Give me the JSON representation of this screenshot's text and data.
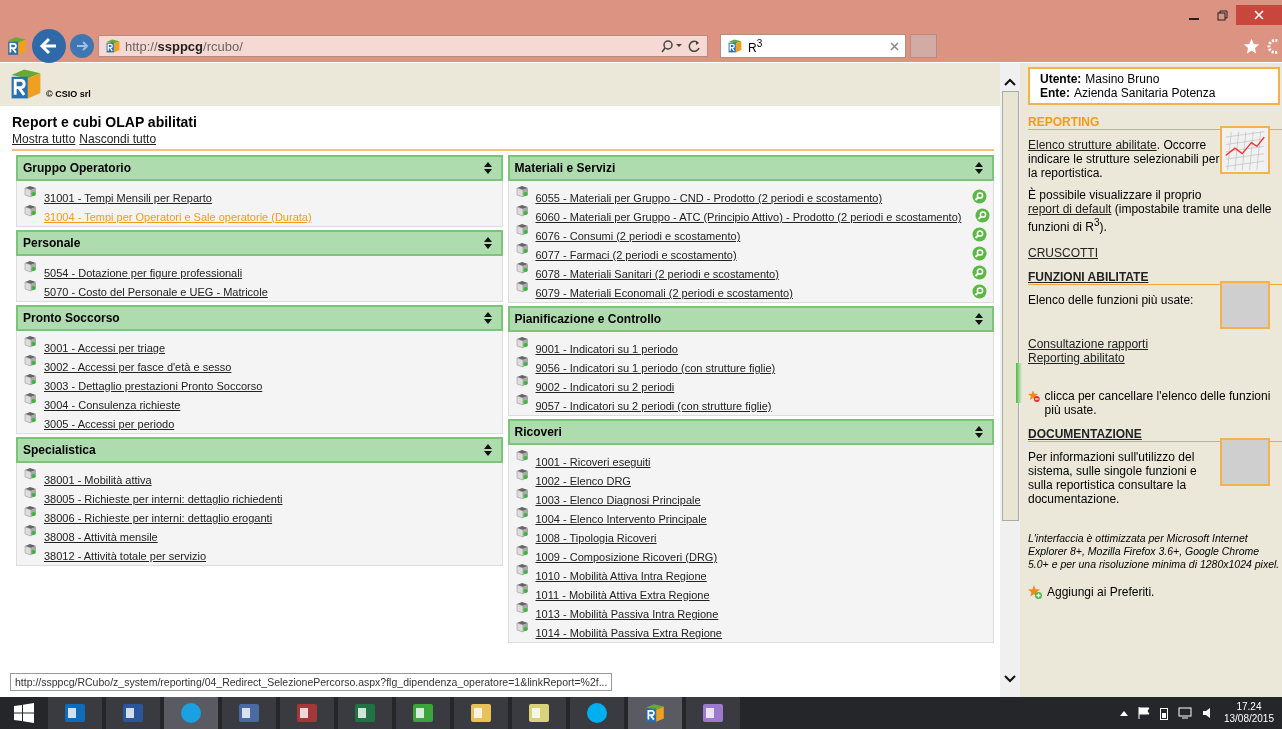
{
  "browser": {
    "url": "http://**ssppcg**/rcubo/",
    "tab_title": "R$^{3}$"
  },
  "header": {
    "copyright": "© CSIO srl",
    "user": [
      {
        "label": "Utente:",
        "value": "Masino Bruno"
      },
      {
        "label": "Ente:",
        "value": "Azienda Sanitaria Potenza"
      }
    ]
  },
  "main": {
    "title": "Report e cubi OLAP abilitati",
    "links": [
      "Mostra tutto",
      "Nascondi tutto"
    ],
    "columns": [
      [
        {
          "title": "Gruppo Operatorio",
          "item_actions": false,
          "items": [
            {
              "text": "31001 - Tempi Mensili per Reparto",
              "highlighted": false
            },
            {
              "text": "31004 - Tempi per Operatori e Sale operatorie (Durata)",
              "highlighted": true
            }
          ]
        },
        {
          "title": "Personale",
          "item_actions": false,
          "items": [
            {
              "text": "5054 - Dotazione per figure professionali ",
              "highlighted": false
            },
            {
              "text": "5070 - Costo del Personale e UEG - Matricole",
              "highlighted": false
            }
          ]
        },
        {
          "title": "Pronto Soccorso",
          "item_actions": false,
          "items": [
            {
              "text": "3001 - Accessi per triage",
              "highlighted": false
            },
            {
              "text": "3002 - Accessi per fasce d'età e sesso",
              "highlighted": false
            },
            {
              "text": "3003 - Dettaglio prestazioni Pronto Soccorso",
              "highlighted": false
            },
            {
              "text": "3004 - Consulenza richieste",
              "highlighted": false
            },
            {
              "text": "3005 - Accessi per periodo",
              "highlighted": false
            }
          ]
        },
        {
          "title": "Specialistica",
          "item_actions": false,
          "items": [
            {
              "text": "38001 - Mobilità attiva",
              "highlighted": false
            },
            {
              "text": "38005 - Richieste per interni: dettaglio richiedenti",
              "highlighted": false
            },
            {
              "text": "38006 - Richieste per interni: dettaglio eroganti",
              "highlighted": false
            },
            {
              "text": "38008 - Attività mensile",
              "highlighted": false
            },
            {
              "text": "38012 - Attività totale per servizio",
              "highlighted": false
            }
          ]
        }
      ],
      [
        {
          "title": "Materiali e Servizi",
          "item_actions": true,
          "items": [
            {
              "text": "6055 - Materiali per Gruppo - CND - Prodotto (2 periodi e scostamento) ",
              "highlighted": false
            },
            {
              "text": "6060 - Materiali per Gruppo - ATC (Principio Attivo) - Prodotto (2 periodi e scostamento)",
              "highlighted": false
            },
            {
              "text": "6076 - Consumi (2 periodi e scostamento)",
              "highlighted": false
            },
            {
              "text": "6077 - Farmaci (2 periodi e scostamento)",
              "highlighted": false
            },
            {
              "text": "6078 - Materiali Sanitari (2 periodi e scostamento)",
              "highlighted": false
            },
            {
              "text": "6079 - Materiali Economali (2 periodi e scostamento)",
              "highlighted": false
            }
          ]
        },
        {
          "title": "Pianificazione e Controllo",
          "item_actions": false,
          "items": [
            {
              "text": "9001 - Indicatori su 1 periodo",
              "highlighted": false
            },
            {
              "text": "9056 - Indicatori su 1 periodo (con strutture figlie)",
              "highlighted": false
            },
            {
              "text": "9002 - Indicatori su 2 periodi",
              "highlighted": false
            },
            {
              "text": "9057 - Indicatori su 2 periodi (con strutture figlie)",
              "highlighted": false
            }
          ]
        },
        {
          "title": "Ricoveri",
          "item_actions": false,
          "items": [
            {
              "text": "1001 - Ricoveri eseguiti",
              "highlighted": false
            },
            {
              "text": "1002 - Elenco DRG",
              "highlighted": false
            },
            {
              "text": "1003 - Elenco Diagnosi Principale",
              "highlighted": false
            },
            {
              "text": "1004 - Elenco Intervento Principale",
              "highlighted": false
            },
            {
              "text": "1008 - Tipologia Ricoveri",
              "highlighted": false
            },
            {
              "text": "1009 - Composizione Ricoveri (DRG)",
              "highlighted": false
            },
            {
              "text": "1010 - Mobilità Attiva Intra Regione",
              "highlighted": false
            },
            {
              "text": "1011 - Mobilità Attiva Extra Regione",
              "highlighted": false
            },
            {
              "text": "1013 - Mobilità Passiva Intra Regione",
              "highlighted": false
            },
            {
              "text": "1014 - Mobilità Passiva Extra Regione",
              "highlighted": false
            }
          ]
        }
      ]
    ]
  },
  "status_text": "http://ssppcg/RCubo/z_system/reporting/04_Redirect_SelezionePercorso.aspx?flg_dipendenza_operatore=1&linkReport=%2f...",
  "sidebar": {
    "sections": [
      {
        "kind": "accent",
        "title": "REPORTING",
        "paragraphs": [
          [
            {
              "text": "Elenco strutture abilitate",
              "link": true
            },
            {
              "text": ". Occorre indicare le strutture selezionabili per la reportistica.",
              "link": false
            }
          ],
          [
            {
              "text": "È possibile visualizzare il proprio ",
              "link": false
            },
            {
              "text": "report di default",
              "link": true
            },
            {
              "text": " (impostabile tramite una delle funzioni di R$^{3}$).",
              "link": false
            }
          ]
        ],
        "links": [
          "CRUSCOTTI"
        ]
      },
      {
        "kind": "plain",
        "title": "FUNZIONI ABILITATE",
        "paragraphs": [
          [
            {
              "text": "Elenco delle funzioni più usate:",
              "link": false
            }
          ]
        ],
        "links": [
          "Consultazione rapporti",
          "Reporting abilitato"
        ],
        "star_note": {
          "kind": "remove",
          "text": "clicca per cancellare l'elenco delle funzioni più usate."
        }
      },
      {
        "kind": "plain",
        "title": "DOCUMENTAZIONE",
        "paragraphs": [
          [
            {
              "text": "Per informazioni sull'utilizzo del sistema, sulle singole funzioni e sulla reportistica consultare la documentazione.",
              "link": false
            }
          ]
        ]
      }
    ],
    "note": "L'interfaccia è ottimizzata per Microsoft Internet Explorer 8+, Mozilla Firefox 3.6+, Google Chrome 5.0+ e per una risoluzione minima di 1280x1024 pixel.",
    "favorites": {
      "kind": "add",
      "text": "Aggiungi ai Preferiti."
    }
  },
  "taskbar": {
    "apps": [
      {
        "kind": "mail",
        "selected": false
      },
      {
        "kind": "word",
        "selected": false
      },
      {
        "kind": "browser",
        "selected": true
      },
      {
        "kind": "remote",
        "selected": false
      },
      {
        "kind": "access",
        "selected": false
      },
      {
        "kind": "excel",
        "selected": false
      },
      {
        "kind": "store",
        "selected": false
      },
      {
        "kind": "folder",
        "selected": false
      },
      {
        "kind": "files",
        "selected": false
      },
      {
        "kind": "skype",
        "selected": false
      },
      {
        "kind": "cube",
        "selected": true
      },
      {
        "kind": "paint",
        "selected": false
      }
    ],
    "time": "17.24",
    "date": "13/08/2015"
  }
}
